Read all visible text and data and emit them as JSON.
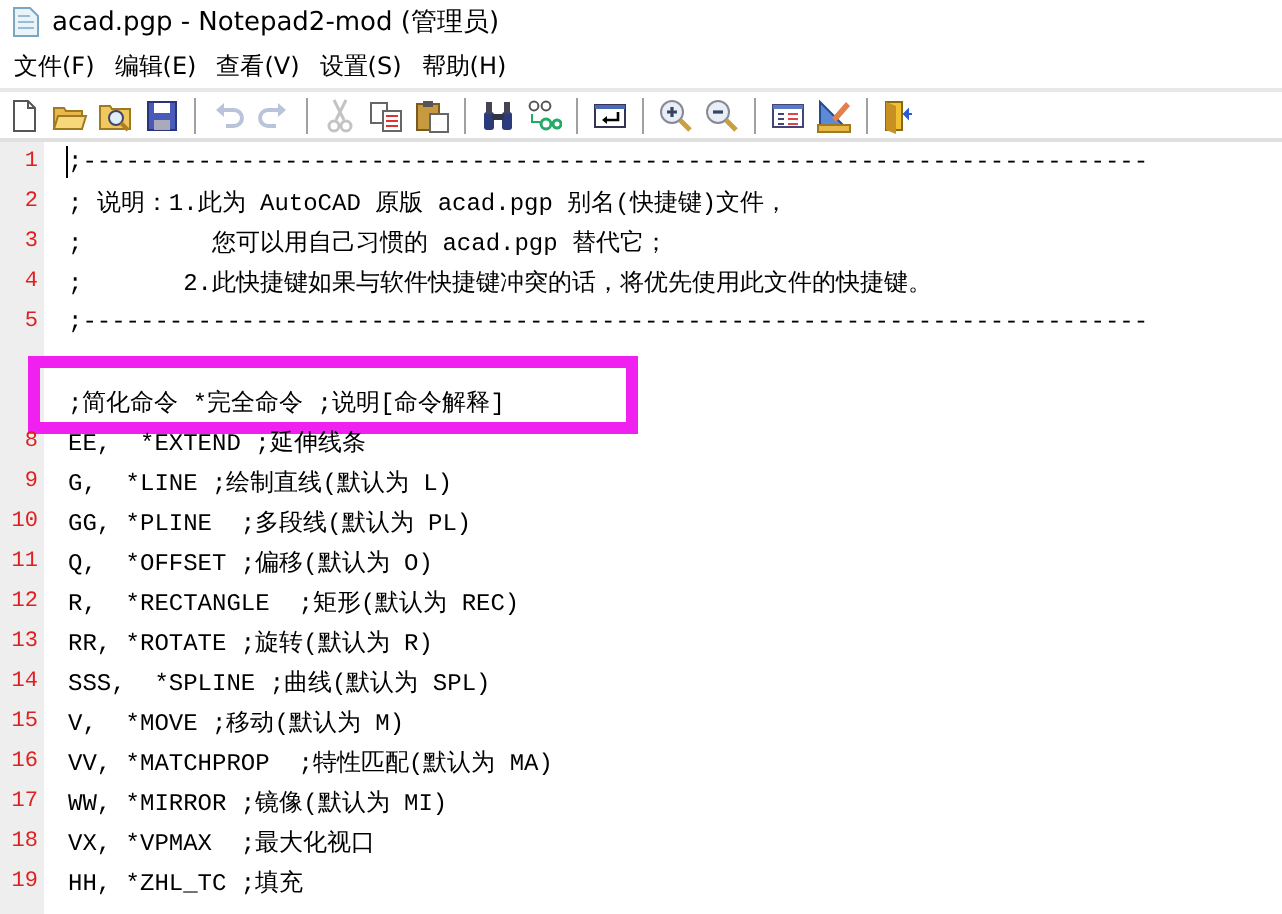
{
  "window": {
    "title": "acad.pgp - Notepad2-mod (管理员)"
  },
  "menu": [
    "文件(F)",
    "编辑(E)",
    "查看(V)",
    "设置(S)",
    "帮助(H)"
  ],
  "toolbar": [
    {
      "kind": "new",
      "disabled": false
    },
    {
      "kind": "open",
      "disabled": false
    },
    {
      "kind": "browse",
      "disabled": false
    },
    {
      "kind": "save",
      "disabled": false
    },
    {
      "kind": "separator"
    },
    {
      "kind": "undo",
      "disabled": true
    },
    {
      "kind": "redo",
      "disabled": true
    },
    {
      "kind": "separator"
    },
    {
      "kind": "cut",
      "disabled": true
    },
    {
      "kind": "copy",
      "disabled": false
    },
    {
      "kind": "paste",
      "disabled": false
    },
    {
      "kind": "separator"
    },
    {
      "kind": "find",
      "disabled": false
    },
    {
      "kind": "replace",
      "disabled": false
    },
    {
      "kind": "separator"
    },
    {
      "kind": "wrap",
      "disabled": false
    },
    {
      "kind": "separator"
    },
    {
      "kind": "zoom-in",
      "disabled": false
    },
    {
      "kind": "zoom-out",
      "disabled": false
    },
    {
      "kind": "separator"
    },
    {
      "kind": "scheme",
      "disabled": false
    },
    {
      "kind": "customize",
      "disabled": false
    },
    {
      "kind": "separator"
    },
    {
      "kind": "exit",
      "disabled": false
    }
  ],
  "editor": {
    "lines": [
      {
        "kind": "text",
        "number": "1",
        "text": ";--------------------------------------------------------------------------",
        "caret": true
      },
      {
        "kind": "text",
        "number": "2",
        "text": "; 说明：1.此为 AutoCAD 原版 acad.pgp 别名(快捷键)文件，"
      },
      {
        "kind": "text",
        "number": "3",
        "text": ";         您可以用自己习惯的 acad.pgp 替代它；"
      },
      {
        "kind": "text",
        "number": "4",
        "text": ";       2.此快捷键如果与软件快捷键冲突的话，将优先使用此文件的快捷键。"
      },
      {
        "kind": "text",
        "number": "5",
        "text": ";--------------------------------------------------------------------------"
      },
      {
        "kind": "blank"
      },
      {
        "kind": "text",
        "text": ";简化命令 *完全命令 ;说明[命令解释]",
        "highlighted": true
      },
      {
        "kind": "text",
        "number": "8",
        "text": "EE,  *EXTEND ;延伸线条"
      },
      {
        "kind": "text",
        "number": "9",
        "text": "G,  *LINE ;绘制直线(默认为 L)"
      },
      {
        "kind": "text",
        "number": "10",
        "text": "GG, *PLINE  ;多段线(默认为 PL)"
      },
      {
        "kind": "text",
        "number": "11",
        "text": "Q,  *OFFSET ;偏移(默认为 O)"
      },
      {
        "kind": "text",
        "number": "12",
        "text": "R,  *RECTANGLE  ;矩形(默认为 REC)"
      },
      {
        "kind": "text",
        "number": "13",
        "text": "RR, *ROTATE ;旋转(默认为 R)"
      },
      {
        "kind": "text",
        "number": "14",
        "text": "SSS,  *SPLINE ;曲线(默认为 SPL)"
      },
      {
        "kind": "text",
        "number": "15",
        "text": "V,  *MOVE ;移动(默认为 M)"
      },
      {
        "kind": "text",
        "number": "16",
        "text": "VV, *MATCHPROP  ;特性匹配(默认为 MA)"
      },
      {
        "kind": "text",
        "number": "17",
        "text": "WW, *MIRROR ;镜像(默认为 MI)"
      },
      {
        "kind": "text",
        "number": "18",
        "text": "VX, *VPMAX  ;最大化视口"
      },
      {
        "kind": "text",
        "number": "19",
        "text": "HH, *ZHL_TC ;填充"
      }
    ]
  }
}
